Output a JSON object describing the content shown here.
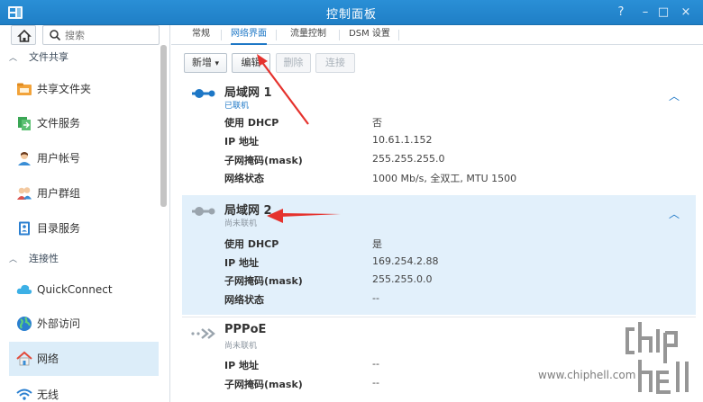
{
  "window": {
    "title": "控制面板",
    "controls": [
      "?",
      "–",
      "□",
      "×"
    ]
  },
  "sidebar": {
    "search_placeholder": "搜索",
    "sections": [
      {
        "label": "文件共享",
        "items": [
          {
            "label": "共享文件夹",
            "icon": "folder-share-icon"
          },
          {
            "label": "文件服务",
            "icon": "file-services-icon"
          },
          {
            "label": "用户帐号",
            "icon": "user-icon"
          },
          {
            "label": "用户群组",
            "icon": "group-icon"
          },
          {
            "label": "目录服务",
            "icon": "directory-icon"
          }
        ]
      },
      {
        "label": "连接性",
        "items": [
          {
            "label": "QuickConnect",
            "icon": "cloud-icon"
          },
          {
            "label": "外部访问",
            "icon": "globe-icon"
          },
          {
            "label": "网络",
            "icon": "house-network-icon",
            "active": true
          },
          {
            "label": "无线",
            "icon": "wifi-icon"
          }
        ]
      }
    ]
  },
  "tabs": [
    {
      "label": "常规"
    },
    {
      "label": "网络界面",
      "active": true
    },
    {
      "label": "流量控制"
    },
    {
      "label": "DSM 设置"
    }
  ],
  "toolbar": {
    "create_label": "新增",
    "create_arrow": "▾",
    "edit_label": "编辑",
    "delete_label": "删除",
    "connect_label": "连接"
  },
  "interfaces": [
    {
      "name": "局域网 1",
      "status": "已联机",
      "rows": [
        {
          "k": "使用 DHCP",
          "v": "否"
        },
        {
          "k": "IP 地址",
          "v": "10.61.1.152"
        },
        {
          "k": "子网掩码(mask)",
          "v": "255.255.255.0"
        },
        {
          "k": "网络状态",
          "v": "1000 Mb/s, 全双工, MTU 1500"
        }
      ]
    },
    {
      "name": "局域网 2",
      "status": "尚未联机",
      "rows": [
        {
          "k": "使用 DHCP",
          "v": "是"
        },
        {
          "k": "IP 地址",
          "v": "169.254.2.88"
        },
        {
          "k": "子网掩码(mask)",
          "v": "255.255.0.0"
        },
        {
          "k": "网络状态",
          "v": "--"
        }
      ]
    },
    {
      "name": "PPPoE",
      "status": "尚未联机",
      "rows": [
        {
          "k": "IP 地址",
          "v": "--"
        },
        {
          "k": "子网掩码(mask)",
          "v": "--"
        }
      ]
    }
  ],
  "colors": {
    "accent": "#1d77c6",
    "connected": "#1d77c6",
    "disconnected": "#8c96a0",
    "annotation": "#e5322d"
  },
  "watermark": {
    "text": "www.chiphell.com"
  }
}
